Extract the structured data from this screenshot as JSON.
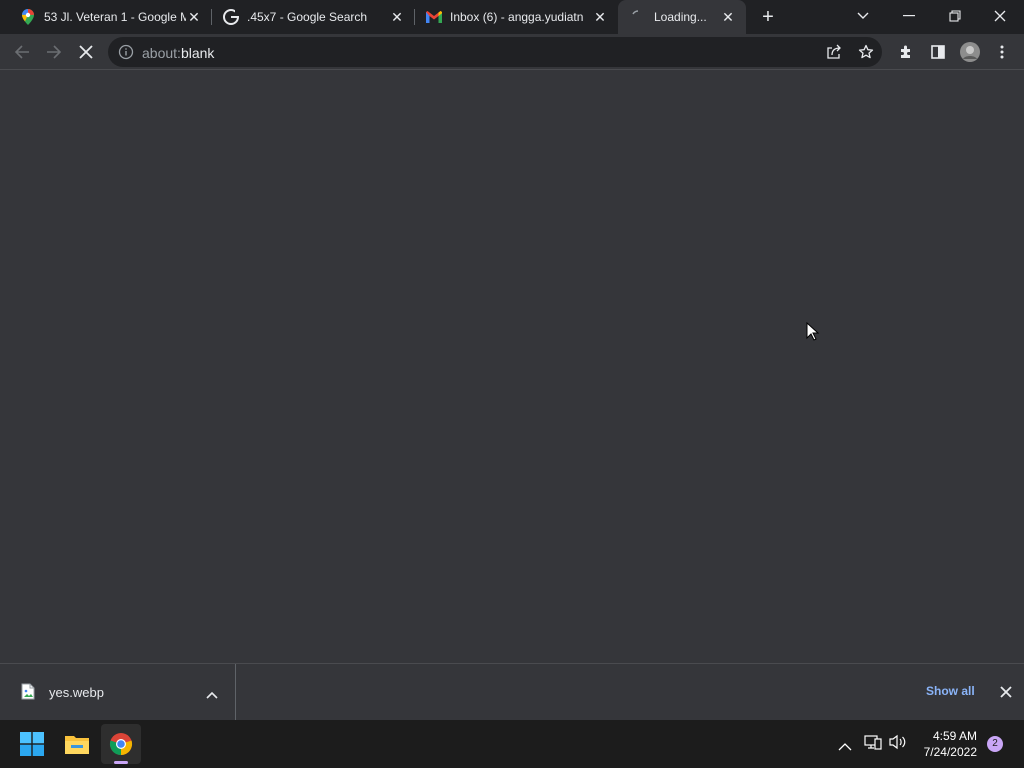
{
  "tabs": [
    {
      "title": "53 Jl. Veteran 1 - Google M",
      "favicon": "maps-pin-icon"
    },
    {
      "title": ".45x7 - Google Search",
      "favicon": "google-g-icon"
    },
    {
      "title": "Inbox (6) - angga.yudiatn",
      "favicon": "gmail-icon"
    },
    {
      "title": "Loading...",
      "favicon": "loading-spinner-icon",
      "active": true
    }
  ],
  "address": {
    "scheme": "about:",
    "path": "blank"
  },
  "downloads": {
    "file_name": "yes.webp",
    "show_all_label": "Show all"
  },
  "taskbar": {
    "time": "4:59 AM",
    "date": "7/24/2022",
    "notification_count": "2"
  },
  "colors": {
    "accent": "#8ab4f8",
    "background": "#35363a",
    "tabstrip": "#202124"
  }
}
